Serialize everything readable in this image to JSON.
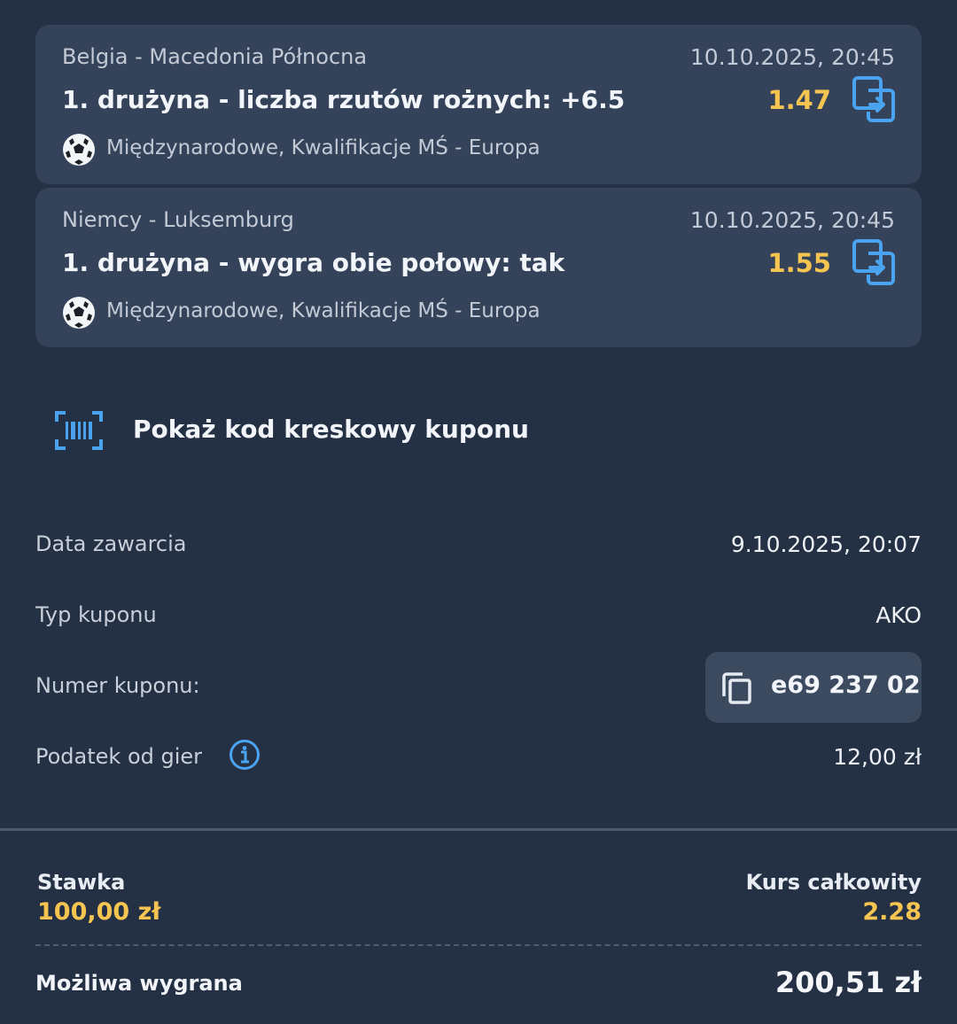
{
  "bets": [
    {
      "match": "Belgia - Macedonia Północna",
      "date": "10.10.2025, 20:45",
      "selection": "1. drużyna - liczba rzutów rożnych: +6.5",
      "odds": "1.47",
      "league": "Międzynarodowe, Kwalifikacje MŚ - Europa",
      "sport_icon": "soccer-ball-icon"
    },
    {
      "match": "Niemcy - Luksemburg",
      "date": "10.10.2025, 20:45",
      "selection": "1. drużyna - wygra obie połowy: tak",
      "odds": "1.55",
      "league": "Międzynarodowe, Kwalifikacje MŚ - Europa",
      "sport_icon": "soccer-ball-icon"
    }
  ],
  "barcode": {
    "label": "Pokaż kod kreskowy kuponu",
    "icon": "barcode-scan-icon"
  },
  "details": {
    "date_label": "Data zawarcia",
    "date_value": "9.10.2025, 20:07",
    "type_label": "Typ kuponu",
    "type_value": "AKO",
    "number_label": "Numer kuponu:",
    "number_value": "e69 237 02",
    "tax_label": "Podatek od gier",
    "tax_value": "12,00 zł"
  },
  "summary": {
    "stake_label": "Stawka",
    "stake_value": "100,00 zł",
    "total_odds_label": "Kurs całkowity",
    "total_odds_value": "2.28",
    "possible_win_label": "Możliwa wygrana",
    "possible_win_value": "200,51 zł"
  },
  "colors": {
    "background": "#243043",
    "card": "#34435a",
    "accent_odds": "#f5c451",
    "icon_blue": "#4aa3ef"
  }
}
